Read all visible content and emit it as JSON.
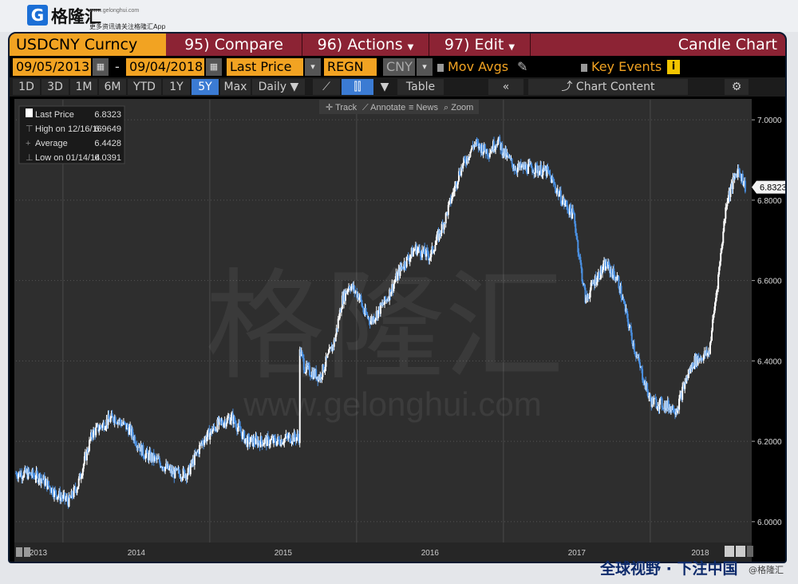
{
  "header": {
    "logo_letter": "G",
    "logo_name": "格隆汇",
    "logo_url": "www.gelonghui.com",
    "logo_tagline": "更多资讯请关注格隆汇App"
  },
  "toolbar": {
    "ticker": "USDCNY Curncy",
    "compare": "95) Compare",
    "actions": "96) Actions",
    "edit": "97) Edit",
    "chart_type": "Candle Chart",
    "start_date": "09/05/2013",
    "end_date": "09/04/2018",
    "date_dash": "-",
    "field": "Last Price",
    "region": "REGN",
    "currency": "CNY",
    "mov_avgs": "Mov Avgs",
    "key_events": "Key Events",
    "info_badge": "i"
  },
  "periods": [
    "1D",
    "3D",
    "1M",
    "6M",
    "YTD",
    "1Y",
    "5Y",
    "Max"
  ],
  "active_period": "5Y",
  "frequency": "Daily",
  "view_toolbar": {
    "table": "Table",
    "collapse": "«",
    "chart_content": "Chart Content",
    "track": "Track",
    "annotate": "Annotate",
    "news": "News",
    "zoom": "Zoom"
  },
  "legend": [
    {
      "label": "Last Price",
      "value": "6.8323"
    },
    {
      "label": "High on 12/16/16",
      "value": "6.9649"
    },
    {
      "label": "Average",
      "value": "6.4428"
    },
    {
      "label": "Low on 01/14/14",
      "value": "6.0391"
    }
  ],
  "watermark": {
    "brand": "格隆汇",
    "url": "www.gelonghui.com"
  },
  "footer": {
    "banner": "全球视野 · 下注中国",
    "handle": "@格隆汇"
  },
  "colors": {
    "candle_up": "#ffffff",
    "candle_down": "#4a90e2",
    "panel_bg": "#2e2e2e",
    "ticker_bg": "#f2a322",
    "header_bg": "#8c2334",
    "active_tab": "#3b7bd3"
  },
  "chart_data": {
    "type": "line",
    "title": "",
    "xlabel": "",
    "ylabel": "",
    "ylim": [
      5.95,
      7.05
    ],
    "yticks": [
      6.0,
      6.2,
      6.4,
      6.6,
      6.8,
      7.0
    ],
    "ytick_labels": [
      "6.0000",
      "6.2000",
      "6.4000",
      "6.6000",
      "6.8000",
      "7.0000"
    ],
    "xlim": [
      2013.68,
      2018.68
    ],
    "xticks": [
      2013,
      2014,
      2015,
      2016,
      2017,
      2018
    ],
    "xtick_labels": [
      "2013",
      "2014",
      "2015",
      "2016",
      "2017",
      "2018"
    ],
    "last_price_label": "6.8323",
    "series": [
      {
        "name": "",
        "x": [
          2013.68,
          2013.75,
          2013.85,
          2013.95,
          2014.04,
          2014.1,
          2014.2,
          2014.3,
          2014.35,
          2014.45,
          2014.55,
          2014.65,
          2014.75,
          2014.85,
          2014.95,
          2015.05,
          2015.15,
          2015.25,
          2015.35,
          2015.45,
          2015.55,
          2015.61,
          2015.62,
          2015.65,
          2015.75,
          2015.85,
          2015.9,
          2015.95,
          2016.02,
          2016.05,
          2016.1,
          2016.2,
          2016.3,
          2016.4,
          2016.5,
          2016.6,
          2016.7,
          2016.8,
          2016.9,
          2016.96,
          2017.0,
          2017.08,
          2017.2,
          2017.3,
          2017.4,
          2017.48,
          2017.52,
          2017.56,
          2017.62,
          2017.7,
          2017.78,
          2017.9,
          2018.0,
          2018.1,
          2018.18,
          2018.25,
          2018.3,
          2018.4,
          2018.46,
          2018.52,
          2018.57,
          2018.6,
          2018.65
        ],
        "y": [
          6.12,
          6.12,
          6.11,
          6.07,
          6.05,
          6.09,
          6.22,
          6.25,
          6.26,
          6.23,
          6.17,
          6.15,
          6.12,
          6.12,
          6.2,
          6.24,
          6.26,
          6.2,
          6.2,
          6.2,
          6.21,
          6.21,
          6.42,
          6.38,
          6.36,
          6.45,
          6.55,
          6.59,
          6.56,
          6.52,
          6.5,
          6.55,
          6.63,
          6.68,
          6.66,
          6.75,
          6.87,
          6.94,
          6.92,
          6.95,
          6.92,
          6.88,
          6.88,
          6.87,
          6.8,
          6.76,
          6.65,
          6.55,
          6.6,
          6.64,
          6.6,
          6.42,
          6.3,
          6.29,
          6.28,
          6.36,
          6.4,
          6.42,
          6.6,
          6.8,
          6.85,
          6.88,
          6.83
        ]
      }
    ]
  }
}
